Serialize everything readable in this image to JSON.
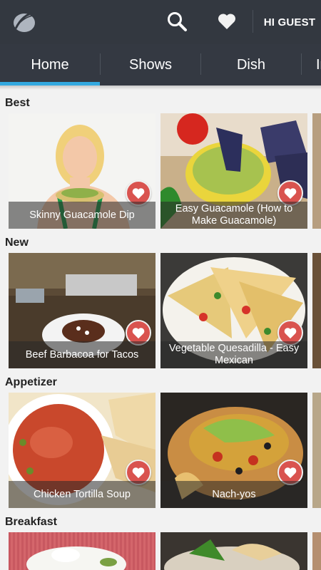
{
  "header": {
    "guest_label": "HI GUEST",
    "icons": [
      "app-logo-icon",
      "search-icon",
      "heart-icon"
    ]
  },
  "tabs": [
    {
      "label": "Home",
      "selected": true
    },
    {
      "label": "Shows",
      "selected": false
    },
    {
      "label": "Dish",
      "selected": false
    },
    {
      "label": "In",
      "selected": false
    }
  ],
  "colors": {
    "toolbar": "#333840",
    "tab_indicator": "#33a9e0",
    "favorite": "#d9534f"
  },
  "sections": [
    {
      "title": "Best",
      "cards": [
        {
          "title": "Skinny Guacamole Dip"
        },
        {
          "title": "Easy Guacamole (How to Make Guacamole)"
        }
      ]
    },
    {
      "title": "New",
      "cards": [
        {
          "title": "Beef Barbacoa for Tacos"
        },
        {
          "title": "Vegetable Quesadilla - Easy Mexican"
        }
      ]
    },
    {
      "title": "Appetizer",
      "cards": [
        {
          "title": "Chicken Tortilla Soup"
        },
        {
          "title": "Nach-yos"
        }
      ]
    },
    {
      "title": "Breakfast",
      "cards": []
    }
  ]
}
